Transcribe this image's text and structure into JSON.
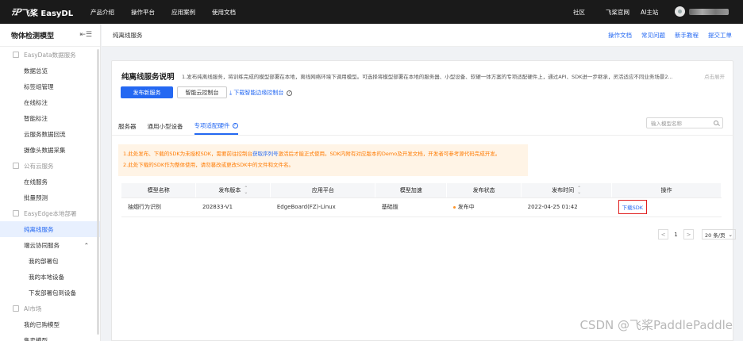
{
  "topnav": {
    "logo_mark": "飞桨",
    "logo_text": "飞桨 EasyDL",
    "links": [
      "产品介绍",
      "操作平台",
      "应用案例",
      "使用文档"
    ],
    "right_links": [
      "社区",
      "飞桨官网",
      "AI主站"
    ]
  },
  "sidebar": {
    "title": "物体检测模型",
    "groups": [
      {
        "label": "EasyData数据服务",
        "items": [
          "数据总览",
          "标签组管理",
          "在线标注",
          "智能标注",
          "云服务数据回流",
          "摄像头数据采集"
        ]
      },
      {
        "label": "公有云服务",
        "items": [
          "在线服务",
          "批量预测"
        ]
      },
      {
        "label": "EasyEdge本地部署",
        "items": [
          "纯离线服务",
          "端云协同服务"
        ],
        "subitems": [
          "我的部署包",
          "我的本地设备",
          "下发部署包到设备"
        ]
      },
      {
        "label": "AI市场",
        "items": [
          "我的已购模型",
          "售卖模型"
        ]
      }
    ]
  },
  "crumb": {
    "current": "纯离线服务",
    "links": [
      "操作文档",
      "常见问题",
      "新手教程",
      "提交工单"
    ]
  },
  "intro": {
    "title": "纯离线服务说明",
    "desc": "1.发布纯离线服务，将训练完成的模型部署在本地，离线网络环境下调用模型。可选择将模型部署在本地的服务器、小型设备、软硬一体方案的专项适配硬件上，通过API、SDK进一步继承，灵活适应不同业务场景2...",
    "expand": "点击展开",
    "publish_btn": "发布新服务",
    "console_btn": "智能云控制台",
    "download_link": "下载智能边缘控制台",
    "help": "?"
  },
  "tabs": [
    "服务器",
    "通用小型设备",
    "专项适配硬件"
  ],
  "search": {
    "placeholder": "输入模型名称"
  },
  "notice": {
    "line1_a": "1.此处发布、下载的SDK为未授权SDK，需要前往控制台",
    "line1_link": "获取序列号",
    "line1_b": "激活后才能正式使用。SDK内附有对应版本的Demo及开发文档，开发者可参考源代码完成开发。",
    "line2": "2.此处下载的SDK作为整体使用，请勿篡改或更改SDK中的文件和文件名。"
  },
  "table": {
    "headers": [
      "模型名称",
      "发布版本",
      "应用平台",
      "模型加速",
      "发布状态",
      "发布时间",
      "操作"
    ],
    "rows": [
      {
        "name": "抽烟行为识别",
        "version": "202833-V1",
        "platform": "EdgeBoard(FZ)-Linux",
        "accel": "基础版",
        "status": "发布中",
        "time": "2022-04-25 01:42",
        "action": "下载SDK"
      }
    ]
  },
  "pager": {
    "prev": "<",
    "page": "1",
    "next": ">",
    "size": "20 条/页"
  },
  "watermark": "CSDN @飞桨PaddlePaddle"
}
